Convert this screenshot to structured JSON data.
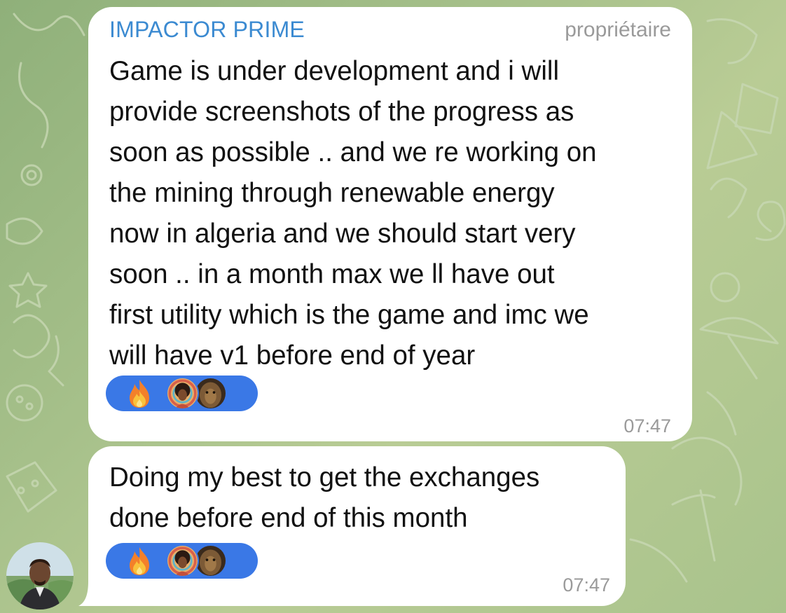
{
  "messages": [
    {
      "sender": "IMPACTOR PRIME",
      "role": "propriétaire",
      "text": "Game is under development and i will\nprovide screenshots of the progress as\nsoon as possible .. and we re working on\nthe mining through renewable energy\nnow in algeria and we should start very\nsoon .. in a month max we ll have out\nfirst utility which is the game and imc we\nwill have v1 before end of year",
      "reaction_icon": "fire-emoji-icon",
      "time": "07:47"
    },
    {
      "text": "Doing my best to get the exchanges\ndone before end of this month",
      "reaction_icon": "fire-emoji-icon",
      "time": "07:47"
    }
  ],
  "colors": {
    "sender_name": "#3b8ad1",
    "reaction_pill": "#3a78e6",
    "meta_text": "#9a9a9a",
    "chat_background": "#a6c08a"
  }
}
